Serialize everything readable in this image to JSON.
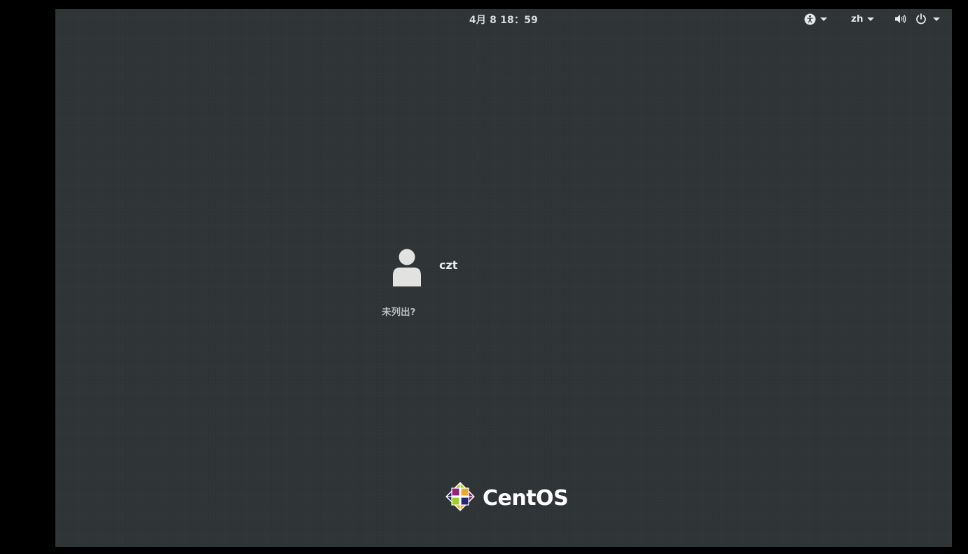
{
  "topbar": {
    "clock": "4月 8  18：59",
    "language": "zh",
    "icons": {
      "accessibility": "accessibility-icon",
      "volume": "volume-icon",
      "power": "power-icon",
      "dropdown": "chevron-down-icon"
    }
  },
  "login": {
    "users": [
      {
        "name": "czt",
        "avatar_icon": "user-avatar-icon"
      }
    ],
    "not_listed_label": "未列出?"
  },
  "branding": {
    "logo_text": "CentOS"
  },
  "colors": {
    "background": "#2e3336",
    "frame": "#000000",
    "text": "#ecedec",
    "muted_text": "#b9bcbb"
  }
}
